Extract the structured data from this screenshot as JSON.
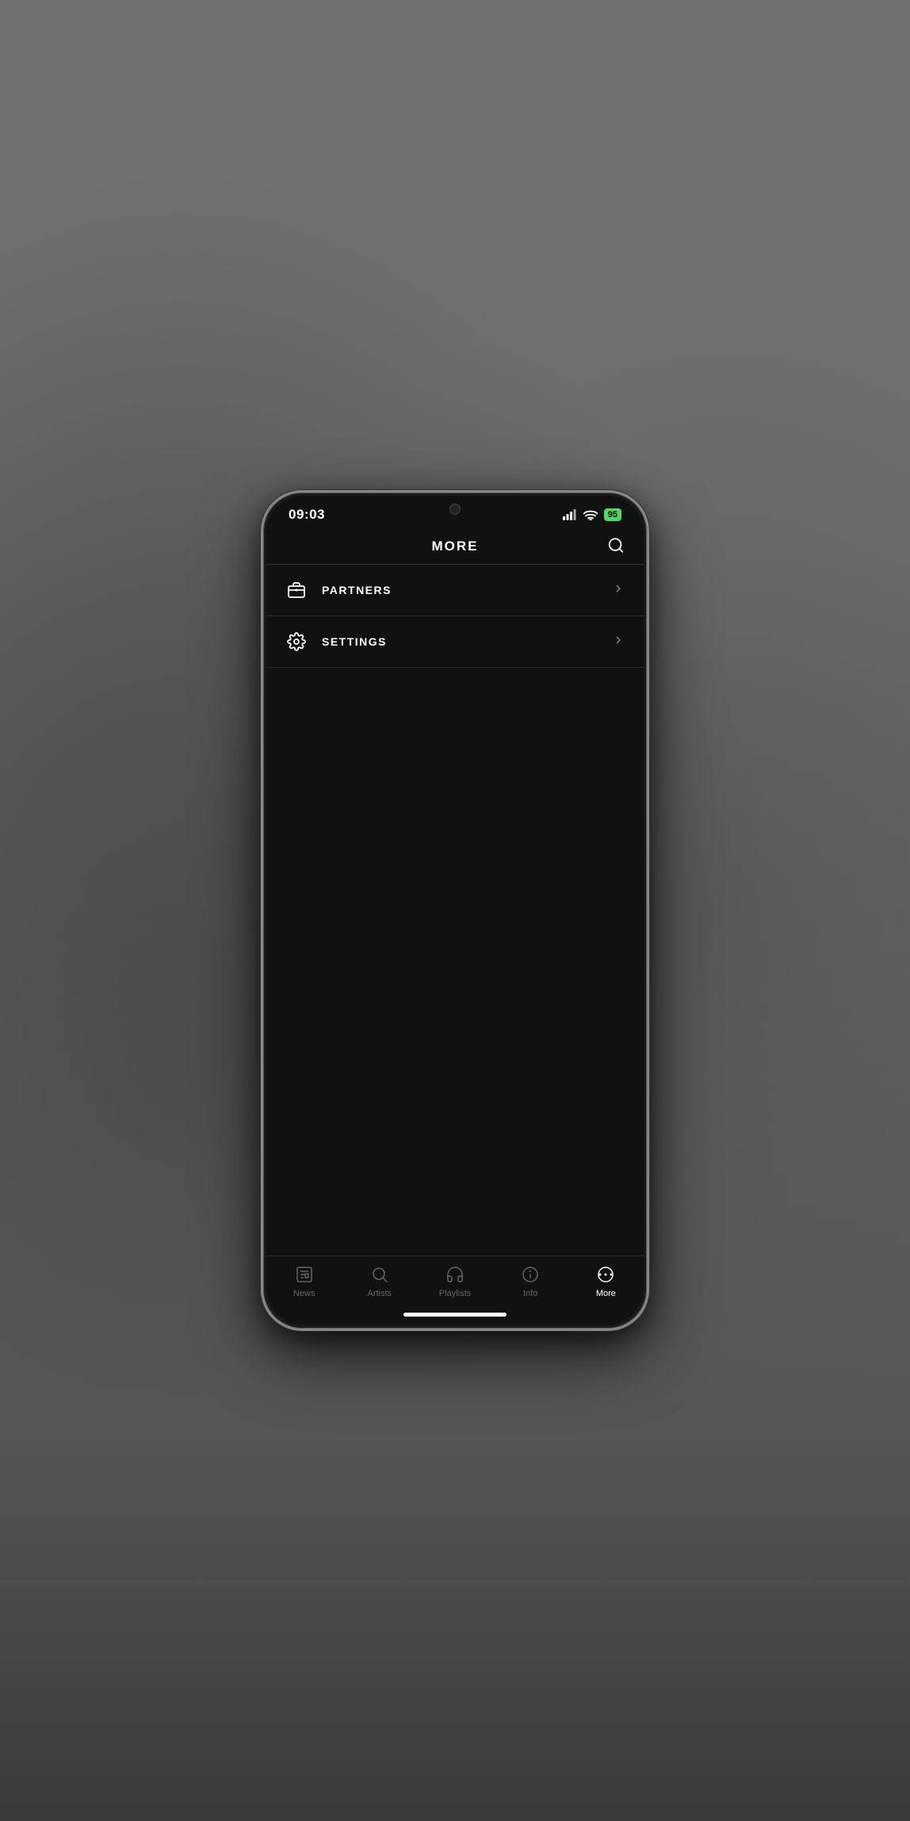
{
  "app": {
    "title": "More",
    "time": "09:03",
    "battery": "95",
    "backgroundDescription": "Concert crowd black and white photo"
  },
  "menu": {
    "items": [
      {
        "id": "partners",
        "label": "PARTNERS",
        "icon": "briefcase"
      },
      {
        "id": "settings",
        "label": "SETTINGS",
        "icon": "gear"
      }
    ]
  },
  "tabs": [
    {
      "id": "news",
      "label": "News",
      "icon": "newspaper",
      "active": false
    },
    {
      "id": "artists",
      "label": "Artists",
      "icon": "search",
      "active": false
    },
    {
      "id": "playlists",
      "label": "Playlists",
      "icon": "headphones",
      "active": false
    },
    {
      "id": "info",
      "label": "Info",
      "icon": "info-circle",
      "active": false
    },
    {
      "id": "more",
      "label": "More",
      "icon": "more-dots",
      "active": true
    }
  ]
}
